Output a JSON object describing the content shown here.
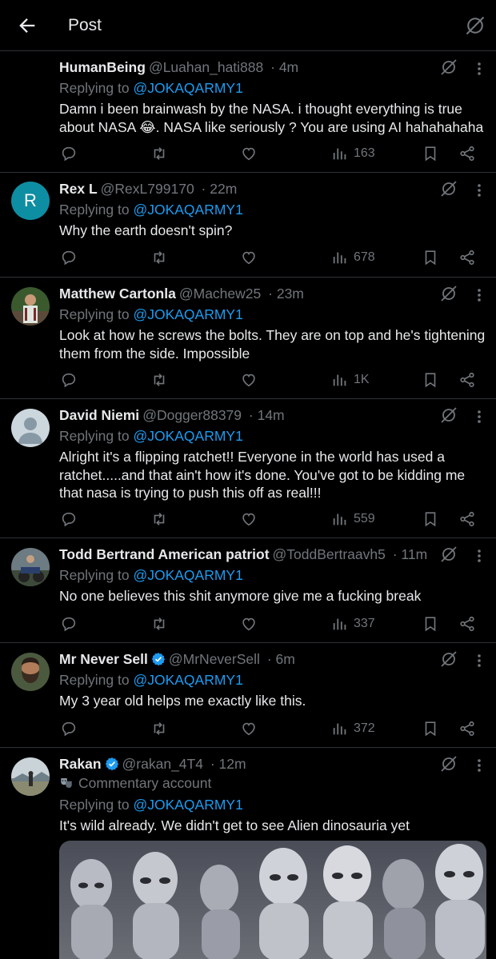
{
  "header": {
    "title": "Post",
    "back_icon": "arrow-left-icon",
    "grok_icon": "grok-icon"
  },
  "colors": {
    "background": "#000000",
    "text": "#e7e9ea",
    "muted": "#71767b",
    "link": "#1d9bf0",
    "divider": "#2f3336",
    "verified": "#1d9bf0"
  },
  "replies": [
    {
      "name": "HumanBeing",
      "handle": "@Luahan_hati888",
      "time": "· 4m",
      "replying_label": "Replying to",
      "mention": "@JOKAQARMY1",
      "text": "Damn i been brainwash by the NASA. i thought everything is true about NASA 😂. NASA like seriously ? You are using AI hahahahaha",
      "views": "163"
    },
    {
      "name": "Rex L",
      "handle": "@RexL799170",
      "time": "· 22m",
      "replying_label": "Replying to",
      "mention": "@JOKAQARMY1",
      "text": "Why the earth doesn't spin?",
      "views": "678",
      "avatar_letter": "R",
      "avatar_color": "#0e8ea3"
    },
    {
      "name": "Matthew Cartonla",
      "handle": "@Machew25",
      "time": "· 23m",
      "replying_label": "Replying to",
      "mention": "@JOKAQARMY1",
      "text": "Look at how he screws the bolts. They are on top and he's tightening them from the side. Impossible",
      "views": "1K"
    },
    {
      "name": "David Niemi",
      "handle": "@Dogger88379",
      "time": "· 14m",
      "replying_label": "Replying to",
      "mention": "@JOKAQARMY1",
      "text": "Alright it's a flipping ratchet!!  Everyone in the world has used a ratchet.....and that ain't how it's done.  You've got to be kidding me that nasa is trying to push this off as real!!!",
      "views": "559"
    },
    {
      "name": "Todd Bertrand American patriot",
      "handle": "@ToddBertraavh5",
      "time": "· 11m",
      "replying_label": "Replying to",
      "mention": "@JOKAQARMY1",
      "text": "No one believes this shit anymore give me a fucking break",
      "views": "337"
    },
    {
      "name": "Mr Never Sell",
      "handle": "@MrNeverSell",
      "time": "· 6m",
      "replying_label": "Replying to",
      "mention": "@JOKAQARMY1",
      "text": "My 3 year old helps me exactly like this.",
      "views": "372",
      "verified": true
    },
    {
      "name": "Rakan",
      "handle": "@rakan_4T4",
      "time": "· 12m",
      "commentary": "Commentary account",
      "replying_label": "Replying to",
      "mention": "@JOKAQARMY1",
      "text": "It's wild already. We didn't get to see Alien dinosauria yet",
      "verified": true
    }
  ]
}
